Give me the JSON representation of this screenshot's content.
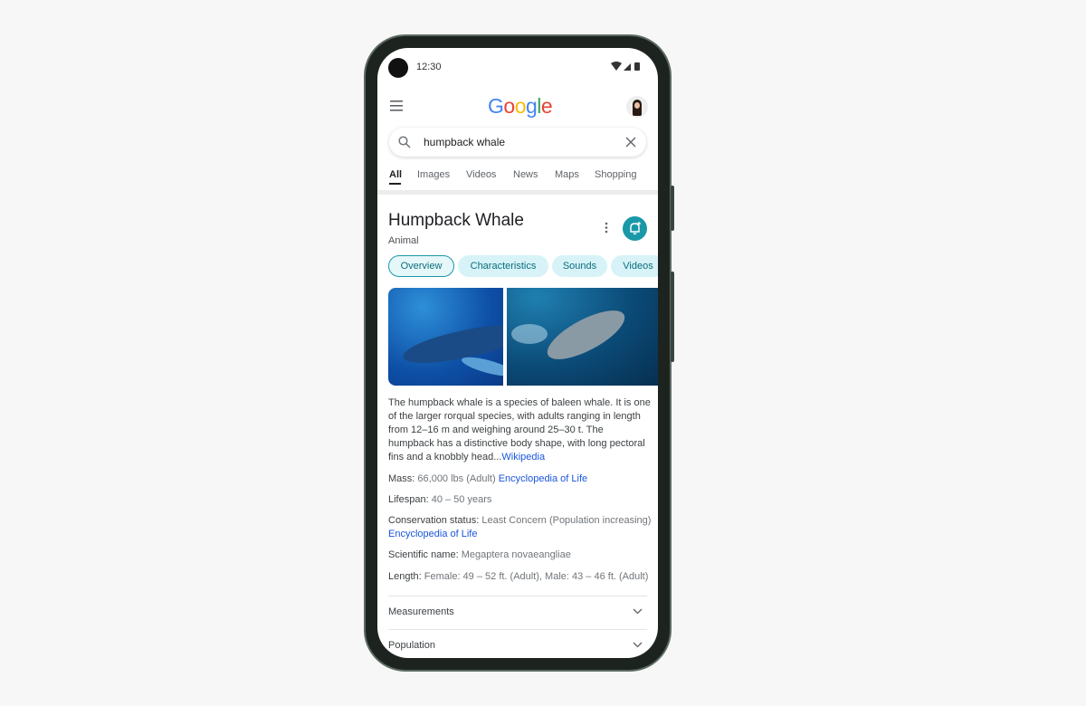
{
  "status": {
    "time": "12:30"
  },
  "header": {
    "logo": "Google",
    "logo_colors": [
      "#4285F4",
      "#EA4335",
      "#FBBC05",
      "#4285F4",
      "#34A853",
      "#EA4335"
    ]
  },
  "search": {
    "value": "humpback whale"
  },
  "tabs": [
    {
      "label": "All",
      "active": true
    },
    {
      "label": "Images"
    },
    {
      "label": "Videos"
    },
    {
      "label": "News"
    },
    {
      "label": "Maps"
    },
    {
      "label": "Shopping"
    }
  ],
  "panel": {
    "title": "Humpback Whale",
    "subtitle": "Animal",
    "accent": "#1a98a8",
    "chips": [
      {
        "label": "Overview",
        "active": true
      },
      {
        "label": "Characteristics"
      },
      {
        "label": "Sounds"
      },
      {
        "label": "Videos"
      }
    ],
    "description": "The humpback whale is a species of baleen whale. It is one of the larger rorqual species, with adults ranging in length from 12–16 m and weighing around 25–30 t. The humpback has a distinctive body shape, with long pectoral fins and a knobbly head...",
    "description_source": "Wikipedia",
    "facts": [
      {
        "label": "Mass:",
        "value": "66,000 lbs (Adult)",
        "source": "Encyclopedia of Life"
      },
      {
        "label": "Lifespan:",
        "value": "40 – 50 years"
      },
      {
        "label": "Conservation status:",
        "value": "Least Concern (Population increasing)",
        "source": "Encyclopedia of Life"
      },
      {
        "label": "Scientific name:",
        "value": "Megaptera novaeangliae"
      },
      {
        "label": "Length:",
        "value": "Female: 49 – 52 ft. (Adult), Male: 43 – 46 ft. (Adult)"
      }
    ],
    "sections": [
      {
        "label": "Measurements"
      },
      {
        "label": "Population"
      }
    ]
  }
}
